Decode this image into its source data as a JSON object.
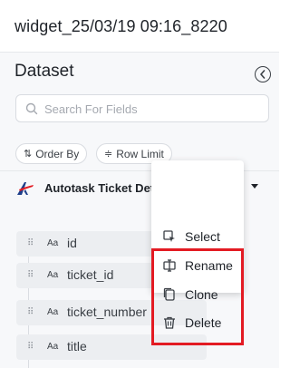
{
  "widget": {
    "title": "widget_25/03/19 09:16_8220"
  },
  "panel": {
    "heading": "Dataset",
    "search": {
      "placeholder": "Search For Fields",
      "value": ""
    },
    "chips": [
      {
        "label": "Order By",
        "icon": "sort-arrows-icon"
      },
      {
        "label": "Row Limit",
        "icon": "row-limit-icon"
      }
    ]
  },
  "dataset": {
    "name": "Autotask Ticket Details - L...",
    "more_label": "···",
    "brand_colors": [
      "#e31b23",
      "#1e3f8a"
    ]
  },
  "fields": [
    {
      "type": "Aa",
      "name": "id"
    },
    {
      "type": "Aa",
      "name": "ticket_id"
    },
    {
      "type": "Aa",
      "name": "ticket_number"
    },
    {
      "type": "Aa",
      "name": "title"
    }
  ],
  "menu": {
    "items": [
      {
        "label": "Select",
        "icon": "select-icon"
      },
      {
        "label": "Rename",
        "icon": "rename-icon"
      },
      {
        "label": "Clone",
        "icon": "clone-icon"
      },
      {
        "label": "Delete",
        "icon": "trash-icon"
      }
    ],
    "highlight_color": "#e31b23"
  }
}
